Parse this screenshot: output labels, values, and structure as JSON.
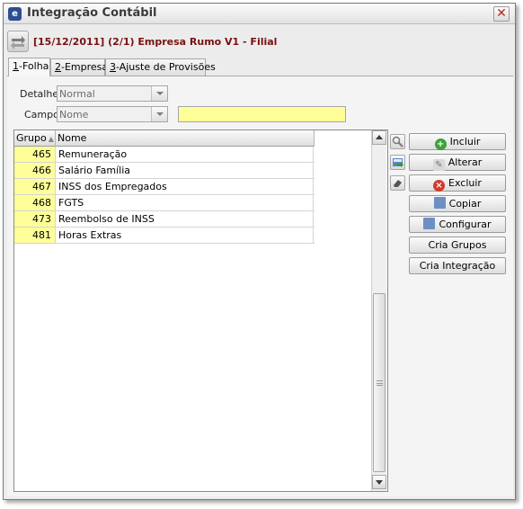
{
  "window": {
    "title": "Integração Contábil",
    "app_icon": "e-icon",
    "close_glyph": "✕"
  },
  "header": {
    "text": "[15/12/2011] (2/1) Empresa Rumo V1 - Filial",
    "color": "#7a1010"
  },
  "tabs": [
    {
      "num": "1",
      "label": "-Folha"
    },
    {
      "num": "2",
      "label": "-Empresa"
    },
    {
      "num": "3",
      "label": "-Ajuste de Provisões"
    }
  ],
  "filters": {
    "detalhe_label": "Detalhe",
    "detalhe_value": "Normal",
    "campo_label": "Campo",
    "campo_value": "Nome",
    "search_value": ""
  },
  "grid": {
    "columns": [
      "Grupo",
      "Nome"
    ],
    "rows": [
      {
        "grupo": "465",
        "nome": "Remuneração"
      },
      {
        "grupo": "466",
        "nome": "Salário Família"
      },
      {
        "grupo": "467",
        "nome": "INSS dos Empregados"
      },
      {
        "grupo": "468",
        "nome": "FGTS"
      },
      {
        "grupo": "473",
        "nome": "Reembolso de INSS"
      },
      {
        "grupo": "481",
        "nome": "Horas Extras"
      }
    ]
  },
  "buttons": {
    "incluir": "Incluir",
    "alterar": "Alterar",
    "excluir": "Excluir",
    "copiar": "Copiar",
    "configurar": "Configurar",
    "cria_grupos": "Cria Grupos",
    "cria_integracao": "Cria Integração"
  },
  "colors": {
    "highlight_yellow": "#ffff99",
    "accent_red": "#7a1010"
  }
}
